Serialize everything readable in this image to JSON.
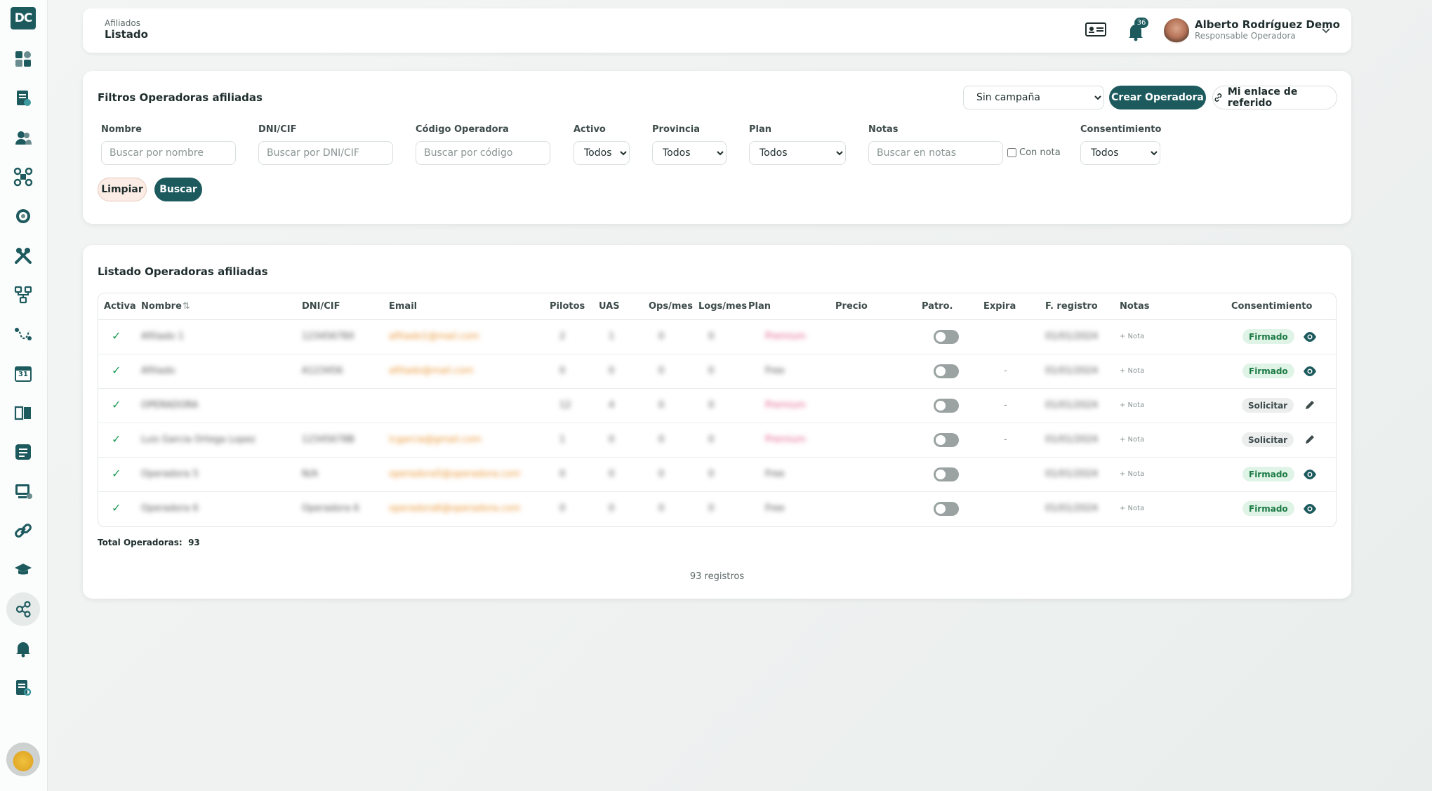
{
  "app": {
    "logo_text": "DC"
  },
  "sidebar": {
    "items": [
      {
        "icon": "dashboard-icon"
      },
      {
        "icon": "document-check-icon"
      },
      {
        "icon": "users-icon"
      },
      {
        "icon": "drone-icon"
      },
      {
        "icon": "globe-icon"
      },
      {
        "icon": "tools-icon"
      },
      {
        "icon": "hierarchy-icon"
      },
      {
        "icon": "route-icon"
      },
      {
        "icon": "calendar-icon",
        "text": "31"
      },
      {
        "icon": "book-icon"
      },
      {
        "icon": "checklist-icon"
      },
      {
        "icon": "monitor-icon"
      },
      {
        "icon": "link-icon"
      },
      {
        "icon": "graduation-cap-icon"
      },
      {
        "icon": "share-nodes-icon",
        "active": true
      },
      {
        "icon": "bell-icon"
      },
      {
        "icon": "report-search-icon"
      }
    ]
  },
  "header": {
    "breadcrumb_parent": "Afiliados",
    "breadcrumb_current": "Listado",
    "notifications_count": "36",
    "user_name": "Alberto Rodríguez Demo",
    "user_role": "Responsable Operadora"
  },
  "filters": {
    "title": "Filtros Operadoras afiliadas",
    "campaign_selected": "Sin campaña",
    "create_button": "Crear Operadora",
    "referral_button": "Mi enlace de referido",
    "fields": {
      "nombre_label": "Nombre",
      "nombre_placeholder": "Buscar por nombre",
      "dni_label": "DNI/CIF",
      "dni_placeholder": "Buscar por DNI/CIF",
      "codigo_label": "Código Operadora",
      "codigo_placeholder": "Buscar por código",
      "activo_label": "Activo",
      "activo_value": "Todos",
      "provincia_label": "Provincia",
      "provincia_value": "Todos",
      "plan_label": "Plan",
      "plan_value": "Todos",
      "notas_label": "Notas",
      "notas_placeholder": "Buscar en notas",
      "con_nota_label": "Con nota",
      "consentimiento_label": "Consentimiento",
      "consentimiento_value": "Todos"
    },
    "clear_button": "Limpiar",
    "search_button": "Buscar"
  },
  "list": {
    "title": "Listado Operadoras afiliadas",
    "columns": {
      "activa": "Activa",
      "nombre": "Nombre",
      "sort_icon": "⇅",
      "dni": "DNI/CIF",
      "email": "Email",
      "pilotos": "Pilotos",
      "uas": "UAS",
      "ops": "Ops/mes",
      "logs": "Logs/mes",
      "plan": "Plan",
      "precio": "Precio",
      "patro": "Patro.",
      "expira": "Expira",
      "fregistro": "F. registro",
      "notas": "Notas",
      "consentimiento": "Consentimiento"
    },
    "rows": [
      {
        "active": "✓",
        "nombre": "Afiliado 1",
        "dni": "12345678X",
        "email": "afiliado1@mail.com",
        "pilotos": "2",
        "uas": "1",
        "ops": "0",
        "logs": "0",
        "plan": "Premium",
        "expira": "",
        "fecha": "01/01/2024",
        "nota": "+ Nota",
        "consent": "Firmado",
        "consent_type": "firmado",
        "action": "eye-icon"
      },
      {
        "active": "✓",
        "nombre": "Afiliado",
        "dni": "A123456",
        "email": "afiliado@mail.com",
        "pilotos": "0",
        "uas": "0",
        "ops": "0",
        "logs": "0",
        "plan": "Free",
        "expira": "-",
        "fecha": "01/01/2024",
        "nota": "+ Nota",
        "consent": "Firmado",
        "consent_type": "firmado",
        "action": "eye-icon"
      },
      {
        "active": "✓",
        "nombre": "OPERADORA",
        "dni": "",
        "email": "",
        "pilotos": "12",
        "uas": "4",
        "ops": "0",
        "logs": "0",
        "plan": "Premium",
        "expira": "-",
        "fecha": "01/01/2024",
        "nota": "+ Nota",
        "consent": "Solicitar",
        "consent_type": "solicitar",
        "action": "pencil-icon"
      },
      {
        "active": "✓",
        "nombre": "Luis Garcia Ortega Lopez",
        "dni": "12345678B",
        "email": "lcgarcia@gmail.com",
        "pilotos": "1",
        "uas": "0",
        "ops": "0",
        "logs": "0",
        "plan": "Premium",
        "expira": "-",
        "fecha": "01/01/2024",
        "nota": "+ Nota",
        "consent": "Solicitar",
        "consent_type": "solicitar",
        "action": "pencil-icon"
      },
      {
        "active": "✓",
        "nombre": "Operadora 5",
        "dni": "N/A",
        "email": "operadora5@operadora.com",
        "pilotos": "0",
        "uas": "0",
        "ops": "0",
        "logs": "0",
        "plan": "Free",
        "expira": "",
        "fecha": "01/01/2024",
        "nota": "+ Nota",
        "consent": "Firmado",
        "consent_type": "firmado",
        "action": "eye-icon"
      },
      {
        "active": "✓",
        "nombre": "Operadora 6",
        "dni": "Operadora 6",
        "email": "operadora6@operadora.com",
        "pilotos": "0",
        "uas": "0",
        "ops": "0",
        "logs": "0",
        "plan": "Free",
        "expira": "",
        "fecha": "01/01/2024",
        "nota": "+ Nota",
        "consent": "Firmado",
        "consent_type": "firmado",
        "action": "eye-icon"
      }
    ],
    "total_label": "Total Operadoras:",
    "total_value": "93",
    "registros": "93 registros"
  },
  "colors": {
    "brand": "#1d5a5e",
    "success": "#1e9a55",
    "email": "#e8922e",
    "plan_premium": "#e05a8a"
  }
}
